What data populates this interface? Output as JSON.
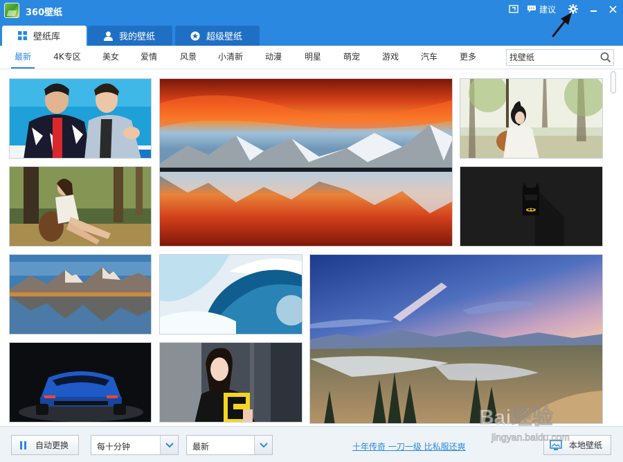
{
  "window": {
    "title": "360壁纸",
    "feedback_label": "建议"
  },
  "tabs": [
    {
      "label": "壁纸库",
      "icon": "grid-icon",
      "active": true
    },
    {
      "label": "我的壁纸",
      "icon": "user-icon",
      "active": false
    },
    {
      "label": "超级壁纸",
      "icon": "star-icon",
      "active": false
    }
  ],
  "categories": [
    "最新",
    "4K专区",
    "美女",
    "爱情",
    "风景",
    "小清新",
    "动漫",
    "明星",
    "萌宠",
    "游戏",
    "汽车",
    "更多"
  ],
  "active_category": "最新",
  "search": {
    "placeholder": "找壁纸"
  },
  "wallpapers": [
    {
      "id": "celebrities-duo",
      "subject": "two men"
    },
    {
      "id": "sunset-lake",
      "subject": "sunset over mountain lake"
    },
    {
      "id": "girl-guitar",
      "subject": "girl with guitar"
    },
    {
      "id": "forest-girl",
      "subject": "girl in forest"
    },
    {
      "id": "batman-dark",
      "subject": "batman"
    },
    {
      "id": "mountain-lake",
      "subject": "mountain lake reflection"
    },
    {
      "id": "ocean-wave",
      "subject": "wave"
    },
    {
      "id": "alpine-valley",
      "subject": "alpine valley"
    },
    {
      "id": "blue-sportscar",
      "subject": "blue sports car"
    },
    {
      "id": "smiling-girl",
      "subject": "smiling girl"
    }
  ],
  "bottom": {
    "auto_change_label": "自动更换",
    "interval_value": "每十分钟",
    "order_value": "最新",
    "promo_text": "十年传奇  一刀一级 比私服还爽",
    "local_wallpaper_label": "本地壁纸"
  },
  "colors": {
    "title_bar": "#2b88e0",
    "tab_inactive": "#1f6fc4",
    "accent": "#2b88e0",
    "bottom_bar": "#eef3f8"
  },
  "watermark": {
    "text": "Bai经验",
    "subtext": "jingyan.baidu.com"
  }
}
